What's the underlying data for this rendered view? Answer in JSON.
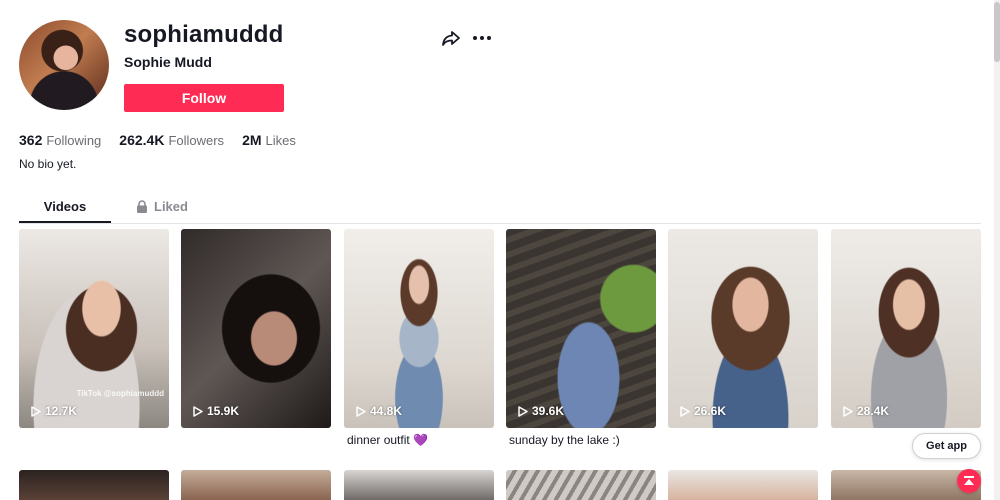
{
  "profile": {
    "username": "sophiamuddd",
    "nickname": "Sophie Mudd",
    "follow_label": "Follow",
    "bio": "No bio yet."
  },
  "stats": {
    "following_count": "362",
    "following_label": "Following",
    "followers_count": "262.4K",
    "followers_label": "Followers",
    "likes_count": "2M",
    "likes_label": "Likes"
  },
  "tabs": {
    "videos": "Videos",
    "liked": "Liked"
  },
  "videos": [
    {
      "views": "12.7K",
      "caption": "",
      "watermark": "TikTok @sophiamuddd"
    },
    {
      "views": "15.9K",
      "caption": ""
    },
    {
      "views": "44.8K",
      "caption": "dinner outfit 💜"
    },
    {
      "views": "39.6K",
      "caption": "sunday by the lake :)"
    },
    {
      "views": "26.6K",
      "caption": ""
    },
    {
      "views": "28.4K",
      "caption": ""
    }
  ],
  "get_app_label": "Get app",
  "icons": {
    "share": "share-icon",
    "more": "more-icon",
    "lock": "lock-icon",
    "play": "play-icon",
    "scroll_top": "arrow-up-icon"
  },
  "colors": {
    "accent": "#fe2c55",
    "text": "#161823",
    "muted": "#6b6c72"
  }
}
